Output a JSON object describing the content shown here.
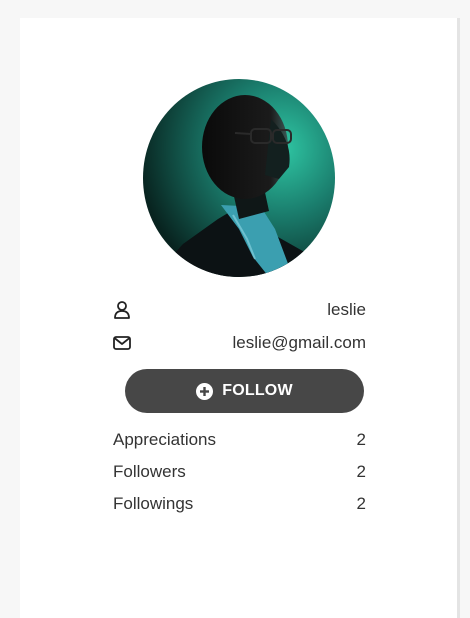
{
  "profile": {
    "username": "leslie",
    "email": "leslie@gmail.com",
    "user_icon": "user-icon",
    "email_icon": "envelope-icon"
  },
  "follow_button": {
    "label": "FOLLOW",
    "icon": "plus-circle-icon",
    "color": "#474747"
  },
  "stats": [
    {
      "label": "Appreciations",
      "value": "2"
    },
    {
      "label": "Followers",
      "value": "2"
    },
    {
      "label": "Followings",
      "value": "2"
    }
  ]
}
